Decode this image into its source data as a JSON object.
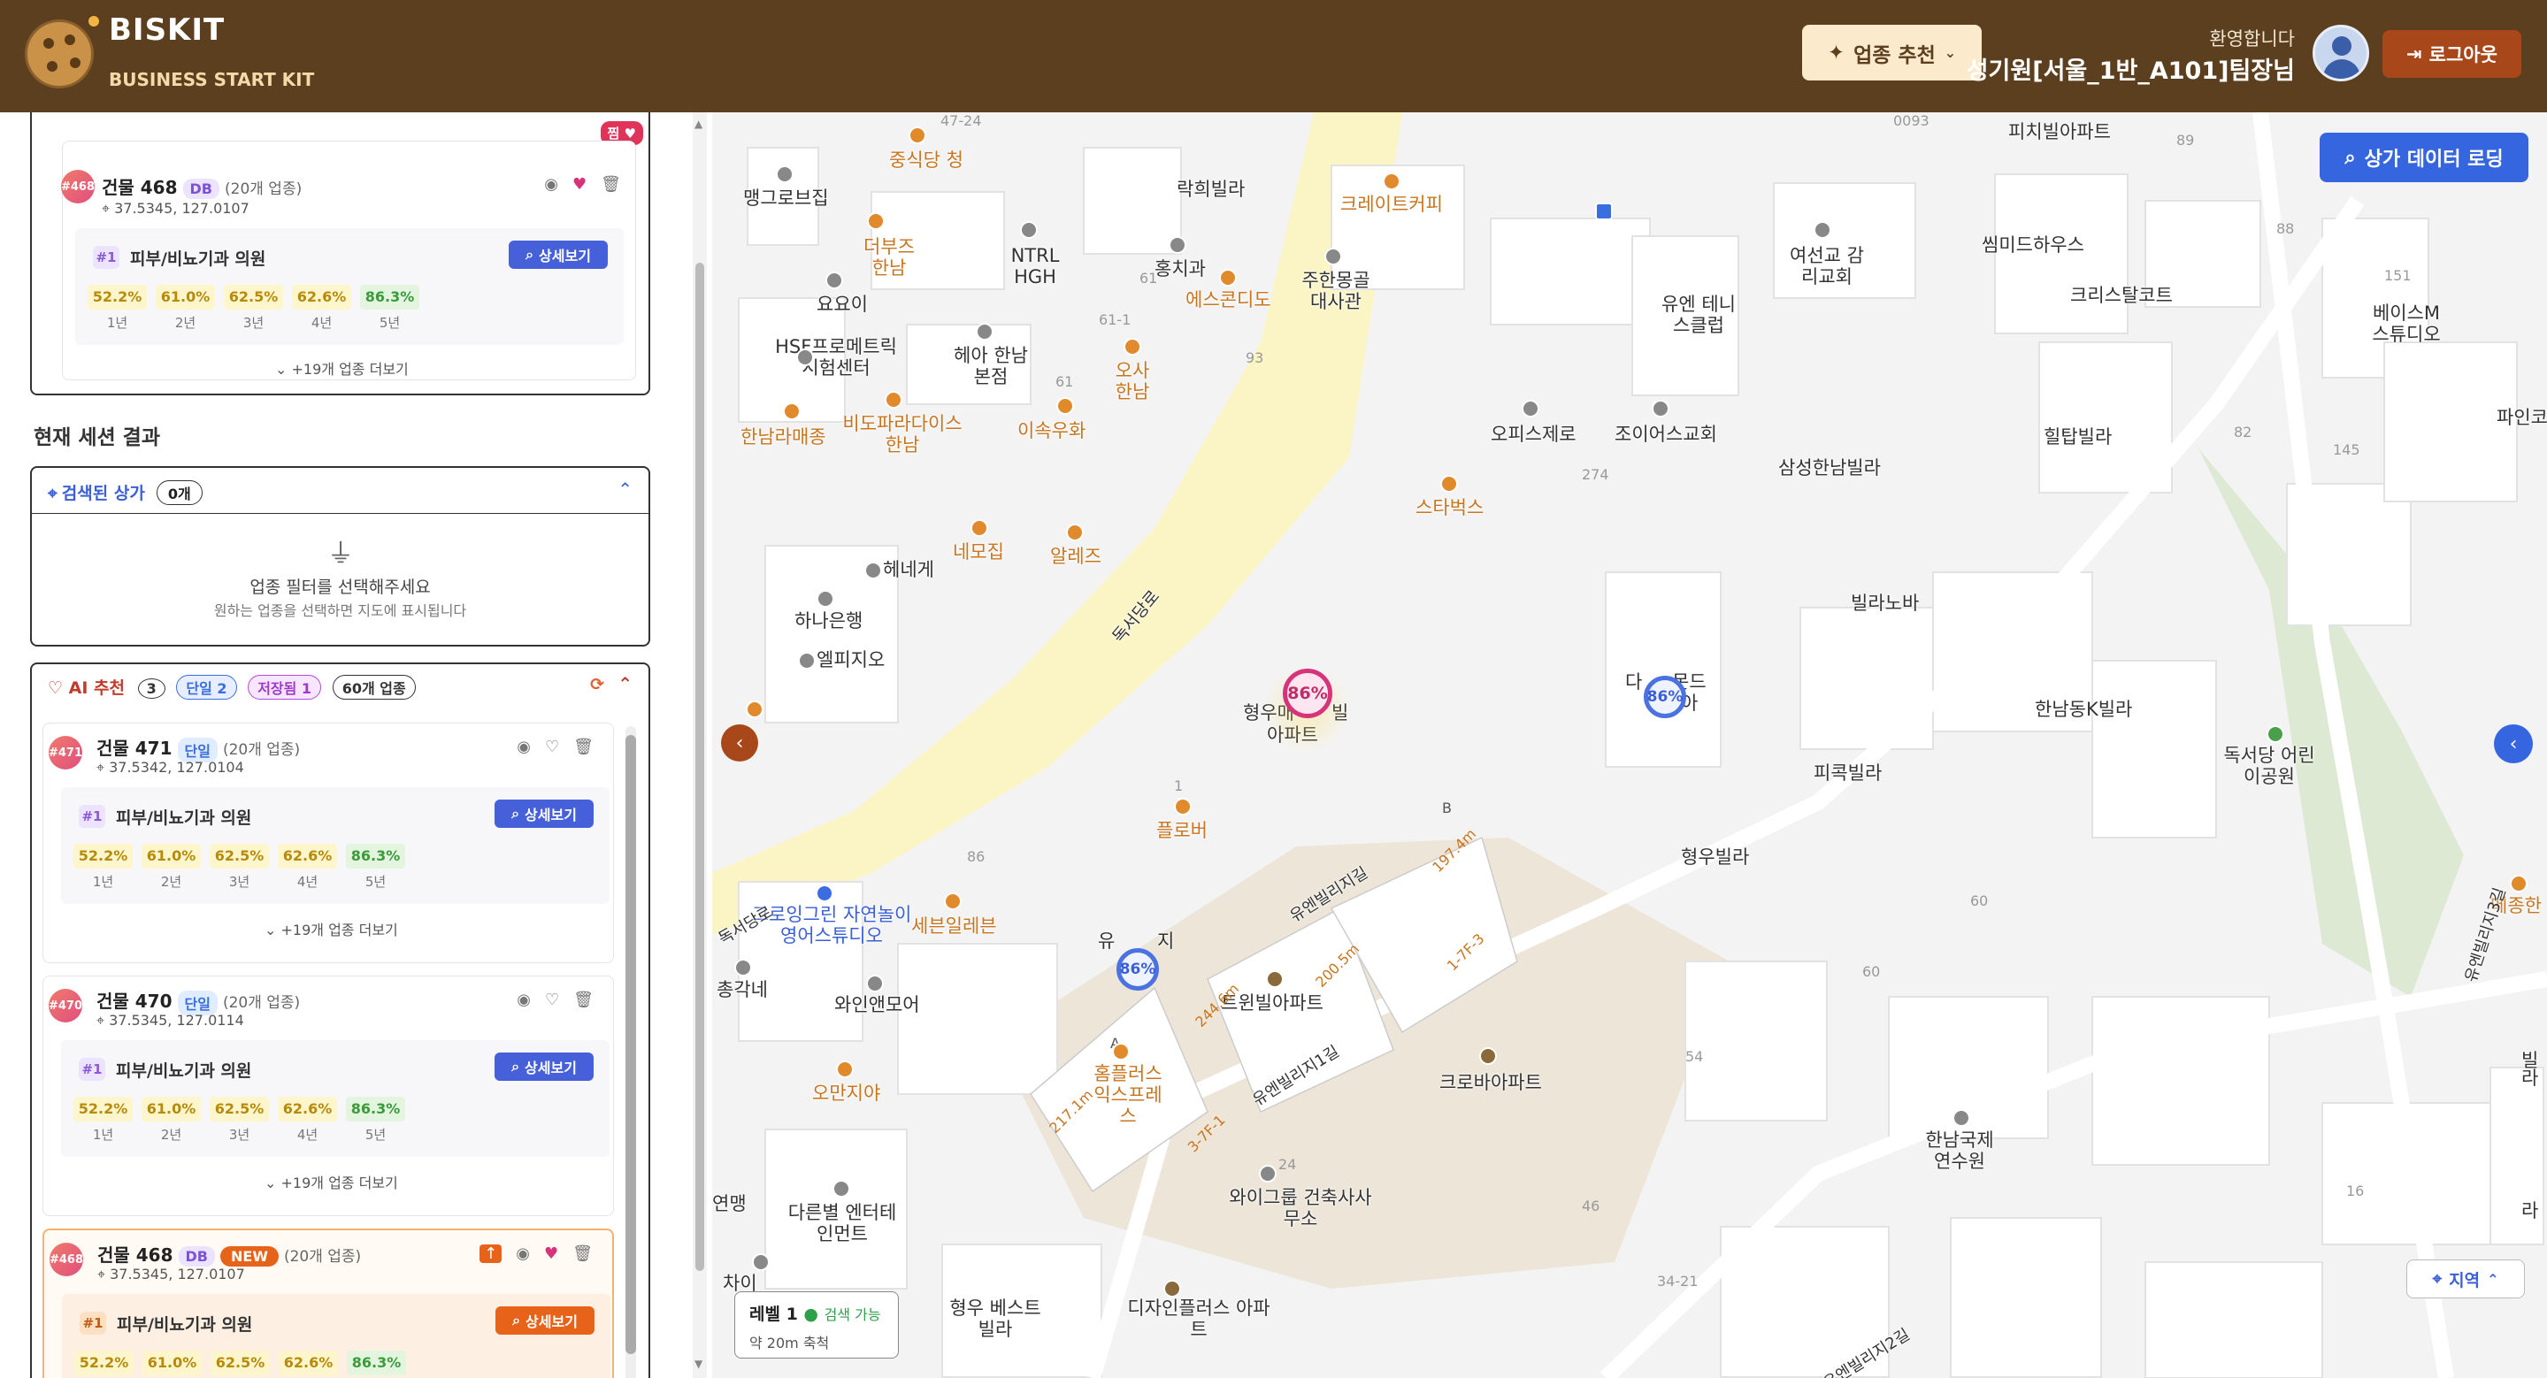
{
  "header": {
    "brand": "BISKIT",
    "subtitle": "BUSINESS START KIT",
    "recommend_label": "업종 추천",
    "welcome": "환영합니다",
    "user_name": "성기원[서울_1반_A101]팀장님",
    "logout_label": "로그아웃"
  },
  "top_card": {
    "badge": "#468",
    "title": "건물 468",
    "tag": "DB",
    "count": "(20개 업종)",
    "coord": "37.5345, 127.0107",
    "corner_tag": "찜",
    "rank": "#1",
    "business": "피부/비뇨기과 의원",
    "detail_label": "상세보기",
    "more": "+19개 업종 더보기"
  },
  "section_title": "현재 세션 결과",
  "search_panel": {
    "title": "검색된 상가",
    "count": "0개",
    "empty_title": "업종 필터를 선택해주세요",
    "empty_sub": "원하는 업종을 선택하면 지도에 표시됩니다"
  },
  "ai_panel": {
    "title": "AI 추천",
    "count": "3",
    "tag_single": "단일 2",
    "tag_saved": "저장됨 1",
    "tag_biz": "60개 업종"
  },
  "percentages": [
    {
      "value": "52.2%",
      "label": "1년"
    },
    {
      "value": "61.0%",
      "label": "2년"
    },
    {
      "value": "62.5%",
      "label": "3년"
    },
    {
      "value": "62.6%",
      "label": "4년"
    },
    {
      "value": "86.3%",
      "label": "5년"
    }
  ],
  "cards": [
    {
      "badge": "#471",
      "title": "건물 471",
      "tag": "단일",
      "count": "(20개 업종)",
      "coord": "37.5342, 127.0104",
      "rank": "#1",
      "business": "피부/비뇨기과 의원",
      "detail_label": "상세보기",
      "more": "+19개 업종 더보기"
    },
    {
      "badge": "#470",
      "title": "건물 470",
      "tag": "단일",
      "count": "(20개 업종)",
      "coord": "37.5345, 127.0114",
      "rank": "#1",
      "business": "피부/비뇨기과 의원",
      "detail_label": "상세보기",
      "more": "+19개 업종 더보기"
    },
    {
      "badge": "#468",
      "title": "건물 468",
      "tag": "DB",
      "tag2": "NEW",
      "count": "(20개 업종)",
      "coord": "37.5345, 127.0107",
      "rank": "#1",
      "business": "피부/비뇨기과 의원",
      "detail_label": "상세보기"
    }
  ],
  "map": {
    "load_button": "상가 데이터 로딩",
    "level_title": "레벨 1",
    "level_status": "검색 가능",
    "level_scale": "약 20m 축척",
    "region_button": "지역",
    "markers": [
      "86%",
      "86%",
      "86%"
    ],
    "labels": [
      "맹그로브집",
      "중식당 청",
      "더부즈 한남",
      "요요이",
      "NTRL HGH",
      "락희빌라",
      "홍치과",
      "에스콘디도",
      "크레이트커피",
      "주한몽골 대사관",
      "여선교 감리교회",
      "피치빌아파트",
      "씸미드하우스",
      "크리스탈코트",
      "베이스M 스튜디오",
      "HSF프로메트릭 시험센터",
      "헤아 한남본점",
      "오사 한남",
      "유엔 테니스클럽",
      "한남라매종",
      "비도파라다이스 한남",
      "이속우화",
      "오피스제로",
      "조이어스교회",
      "삼성한남빌라",
      "힐탑빌라",
      "파인코",
      "스타벅스",
      "네모집",
      "알레즈",
      "헤네게",
      "하나은행",
      "엘피지오",
      "빌라노바",
      "독서당로",
      "형우매",
      "빌",
      "아파트",
      "다",
      "몬드",
      "아",
      "한남동K빌라",
      "피콕빌라",
      "독서당 어린이공원",
      "플로버",
      "형우빌라",
      "그로잉그린 자연놀이 영어스튜디오",
      "세븐일레븐",
      "유",
      "지",
      "총각네",
      "와인앤모어",
      "트윈빌아파트",
      "오만지야",
      "홈플러스 익스프레스",
      "크로바아파트",
      "한남국제 연수원",
      "메종한",
      "빌",
      "라",
      "연맹",
      "다른별 엔터테인먼트",
      "와이그룹 건축사사무소",
      "차이",
      "형우 베스트빌라",
      "디자인플러스 아파트",
      "유엔빌리지길",
      "유엔빌리지1길",
      "유엔빌리지2길",
      "유엔빌리지3길",
      "독서당로",
      "라"
    ],
    "numbers": [
      "47-24",
      "0093",
      "89",
      "88",
      "151",
      "61",
      "61-1",
      "93",
      "61",
      "274",
      "82",
      "145",
      "86",
      "60",
      "60",
      "54",
      "46",
      "34-21",
      "16",
      "24",
      "197.4m",
      "200.5m",
      "244.6m",
      "217.1m",
      "1-7F-3",
      "3-7F-1",
      "B",
      "A",
      "1"
    ]
  }
}
